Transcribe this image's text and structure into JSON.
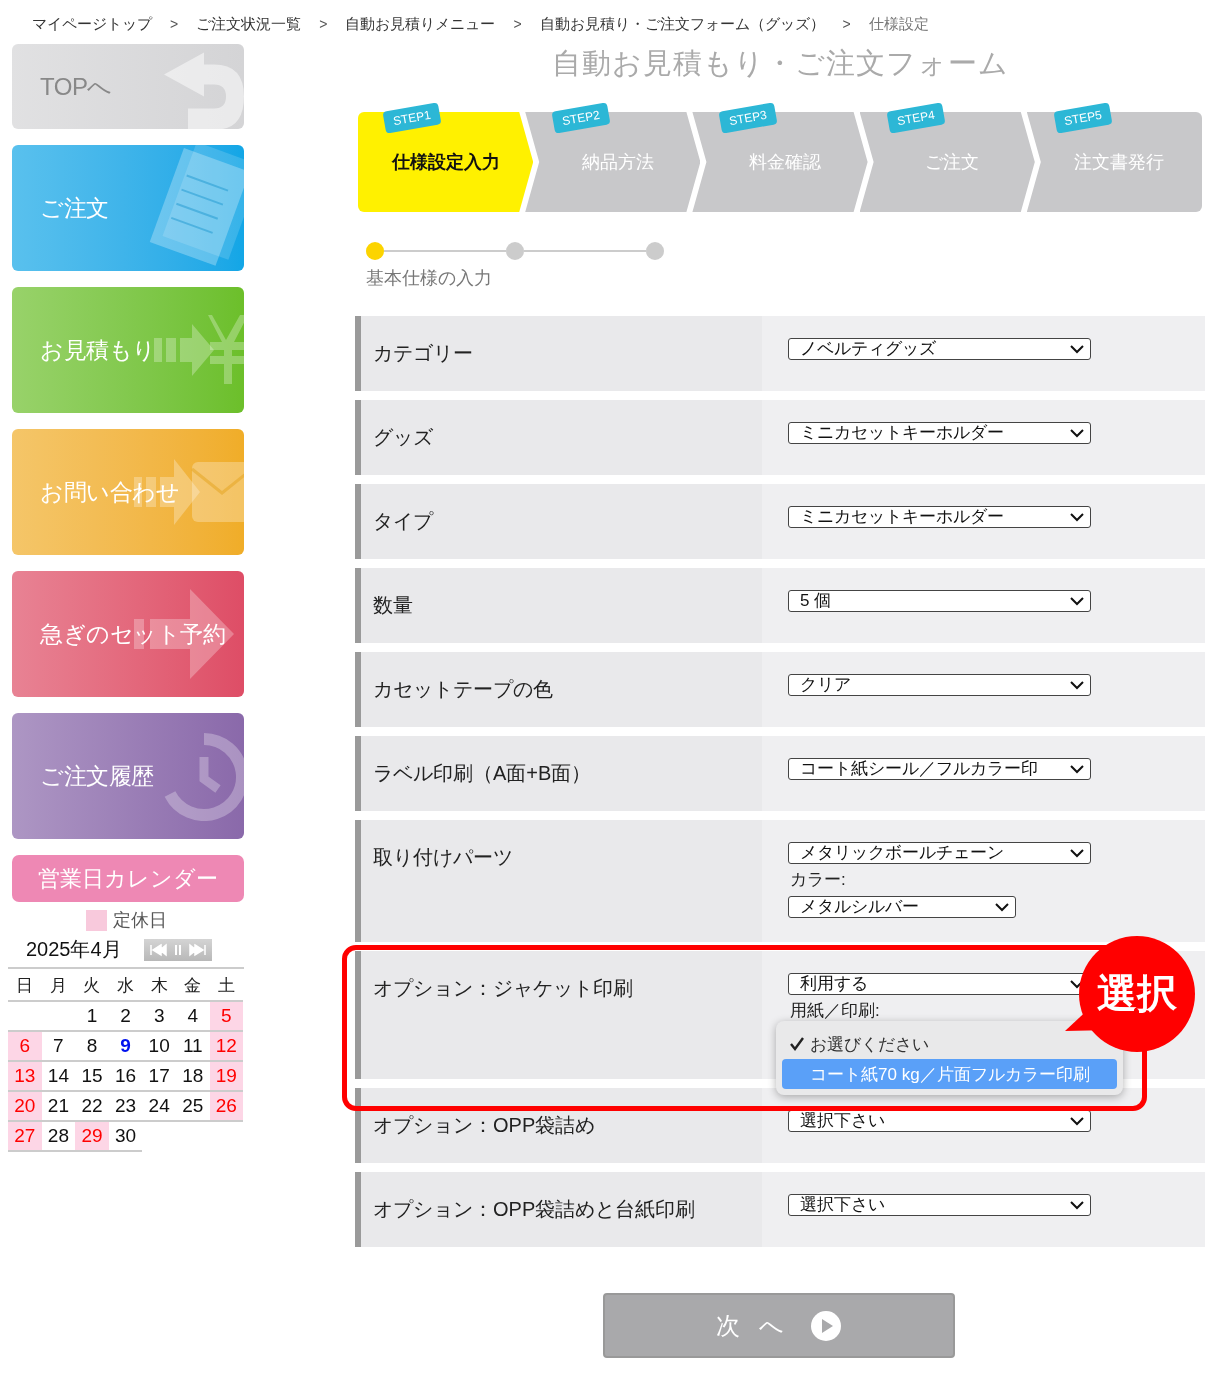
{
  "breadcrumb": {
    "separator": ">",
    "items": [
      {
        "label": "マイページトップ",
        "current": false
      },
      {
        "label": "ご注文状況一覧",
        "current": false
      },
      {
        "label": "自動お見積りメニュー",
        "current": false
      },
      {
        "label": "自動お見積り・ご注文フォーム（グッズ）",
        "current": false
      },
      {
        "label": "仕様設定",
        "current": true
      }
    ]
  },
  "sidebar": {
    "nav": [
      {
        "label": "TOPへ",
        "kind": "back",
        "color": "#d4d4d6"
      },
      {
        "label": "ご注文",
        "kind": "document",
        "color": "#12a6e6"
      },
      {
        "label": "お見積もり",
        "kind": "yen",
        "color": "#6cbf2a"
      },
      {
        "label": "お問い合わせ",
        "kind": "mail",
        "color": "#f0ad28"
      },
      {
        "label": "急ぎのセット予約",
        "kind": "arrow",
        "color": "#de4d66"
      },
      {
        "label": "ご注文履歴",
        "kind": "history",
        "color": "#8a69aa"
      }
    ]
  },
  "calendar": {
    "title": "営業日カレンダー",
    "legend": "定休日",
    "month": "2025年4月",
    "weekdays": [
      "日",
      "月",
      "火",
      "水",
      "木",
      "金",
      "土"
    ],
    "weeks": [
      [
        {
          "kind": "blank"
        },
        {
          "kind": "blank"
        },
        {
          "day": "1",
          "kind": "day"
        },
        {
          "day": "2",
          "kind": "day"
        },
        {
          "day": "3",
          "kind": "day"
        },
        {
          "day": "4",
          "kind": "day"
        },
        {
          "day": "5",
          "kind": "holiday"
        }
      ],
      [
        {
          "day": "6",
          "kind": "holiday"
        },
        {
          "day": "7",
          "kind": "day"
        },
        {
          "day": "8",
          "kind": "day"
        },
        {
          "day": "9",
          "kind": "today"
        },
        {
          "day": "10",
          "kind": "day"
        },
        {
          "day": "11",
          "kind": "day"
        },
        {
          "day": "12",
          "kind": "holiday"
        }
      ],
      [
        {
          "day": "13",
          "kind": "holiday"
        },
        {
          "day": "14",
          "kind": "day"
        },
        {
          "day": "15",
          "kind": "day"
        },
        {
          "day": "16",
          "kind": "day"
        },
        {
          "day": "17",
          "kind": "day"
        },
        {
          "day": "18",
          "kind": "day"
        },
        {
          "day": "19",
          "kind": "holiday"
        }
      ],
      [
        {
          "day": "20",
          "kind": "holiday"
        },
        {
          "day": "21",
          "kind": "day"
        },
        {
          "day": "22",
          "kind": "day"
        },
        {
          "day": "23",
          "kind": "day"
        },
        {
          "day": "24",
          "kind": "day"
        },
        {
          "day": "25",
          "kind": "day"
        },
        {
          "day": "26",
          "kind": "holiday"
        }
      ],
      [
        {
          "day": "27",
          "kind": "holiday"
        },
        {
          "day": "28",
          "kind": "day"
        },
        {
          "day": "29",
          "kind": "holiday"
        },
        {
          "day": "30",
          "kind": "day"
        }
      ]
    ]
  },
  "page_title": "自動お見積もり・ご注文フォーム",
  "steps": [
    {
      "tag": "STEP1",
      "label": "仕様設定入力",
      "selected": true
    },
    {
      "tag": "STEP2",
      "label": "納品方法",
      "selected": false
    },
    {
      "tag": "STEP3",
      "label": "料金確認",
      "selected": false
    },
    {
      "tag": "STEP4",
      "label": "ご注文",
      "selected": false
    },
    {
      "tag": "STEP5",
      "label": "注文書発行",
      "selected": false
    }
  ],
  "progress": {
    "dots": [
      {
        "selected": true
      },
      {
        "selected": false
      },
      {
        "selected": false
      }
    ],
    "label": "基本仕様の入力"
  },
  "form": [
    {
      "label": "カテゴリー",
      "fields": [
        {
          "kind": "select",
          "value": "ノベルティグッズ"
        }
      ]
    },
    {
      "label": "グッズ",
      "fields": [
        {
          "kind": "select",
          "value": "ミニカセットキーホルダー"
        }
      ]
    },
    {
      "label": "タイプ",
      "fields": [
        {
          "kind": "select",
          "value": "ミニカセットキーホルダー"
        }
      ]
    },
    {
      "label": "数量",
      "fields": [
        {
          "kind": "select",
          "value": "5 個"
        }
      ]
    },
    {
      "label": "カセットテープの色",
      "fields": [
        {
          "kind": "select",
          "value": "クリア"
        }
      ]
    },
    {
      "label": "ラベル印刷（A面+B面）",
      "fields": [
        {
          "kind": "select",
          "value": "コート紙シール／フルカラー印"
        }
      ]
    },
    {
      "label": "取り付けパーツ",
      "fields": [
        {
          "kind": "select",
          "value": "メタリックボールチェーン"
        },
        {
          "kind": "caption",
          "text": "カラー:"
        },
        {
          "kind": "select",
          "value": "メタルシルバー"
        }
      ]
    },
    {
      "label": "オプション：ジャケット印刷",
      "highlighted": true,
      "fields": [
        {
          "kind": "select",
          "value": "利用する"
        },
        {
          "kind": "caption",
          "text": "用紙／印刷:"
        }
      ],
      "menu": [
        {
          "label": "お選びください",
          "checked": true,
          "selected": false
        },
        {
          "label": "コート紙70 kg／片面フルカラー印刷",
          "checked": false,
          "selected": true
        }
      ],
      "callout": "選択"
    },
    {
      "label": "オプション：OPP袋詰め",
      "fields": [
        {
          "kind": "select",
          "value": "選択下さい"
        }
      ]
    },
    {
      "label": "オプション：OPP袋詰めと台紙印刷",
      "fields": [
        {
          "kind": "select",
          "value": "選択下さい"
        }
      ]
    }
  ],
  "next_button": "次 へ"
}
